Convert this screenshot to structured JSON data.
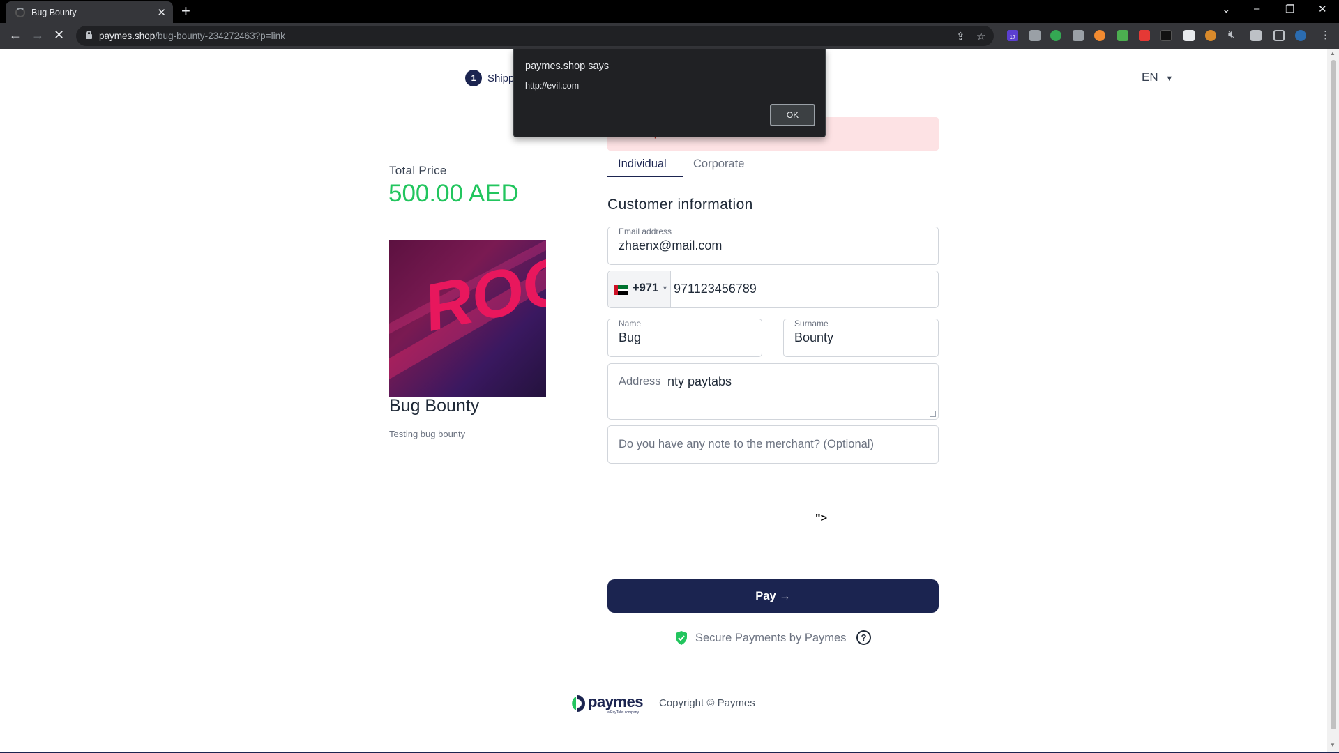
{
  "browser": {
    "tab_title": "Bug Bounty",
    "url_host": "paymes.shop",
    "url_path": "/bug-bounty-234272463?p=link",
    "extension_badge": "17"
  },
  "header": {
    "step_number": "1",
    "step_label": "Shipp",
    "language": "EN"
  },
  "error": {
    "message": "Invalid phone number"
  },
  "product": {
    "total_label": "Total Price",
    "total_value": "500.00 AED",
    "image_text": "ROG",
    "title": "Bug Bounty",
    "description": "Testing bug bounty"
  },
  "tabs": {
    "individual": "Individual",
    "corporate": "Corporate"
  },
  "form": {
    "section_title": "Customer information",
    "email_label": "Email address",
    "email_value": "zhaenx@mail.com",
    "dial_code": "+971",
    "phone_value": "971123456789",
    "name_label": "Name",
    "name_value": "Bug",
    "surname_label": "Surname",
    "surname_value": "Bounty",
    "address_label": "Address",
    "address_value": "nty paytabs",
    "note_placeholder": "Do you have any note to the merchant? (Optional)"
  },
  "injected_text": "\">",
  "pay_button": "Pay →",
  "secure_text": "Secure Payments by Paymes",
  "footer": {
    "logo_text": "paymes",
    "logo_sub": "a PayTabs company",
    "copyright": "Copyright © Paymes"
  },
  "dialog": {
    "title": "paymes.shop says",
    "message": "http://evil.com",
    "ok_label": "OK"
  },
  "colors": {
    "brand_navy": "#1b2450",
    "price_green": "#22c55e",
    "error_bg": "#fde2e4"
  }
}
